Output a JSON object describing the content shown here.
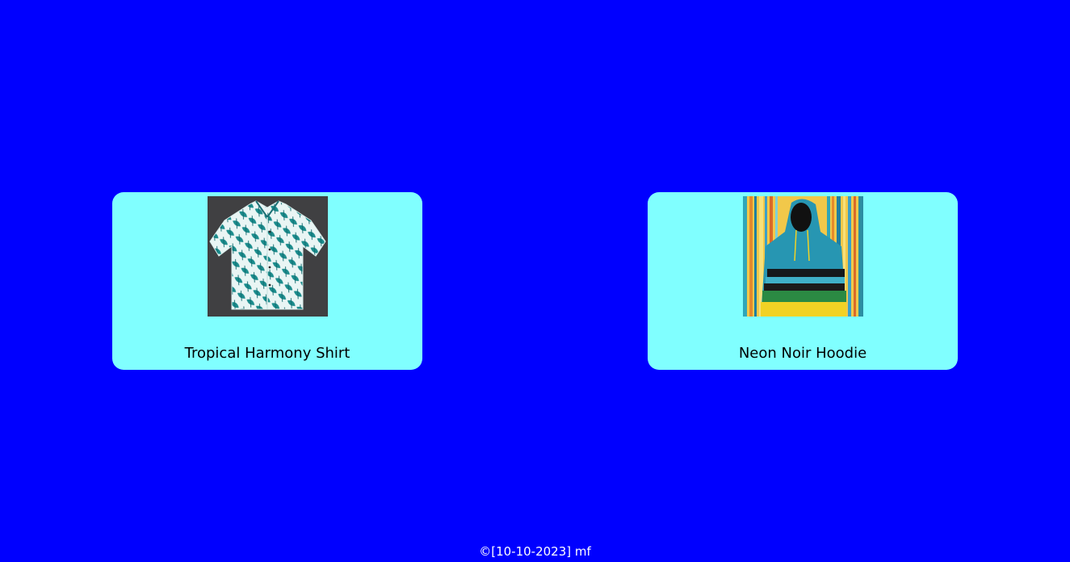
{
  "products": [
    {
      "name": "Tropical Harmony Shirt",
      "image": "tropical-shirt-photo"
    },
    {
      "name": "Neon Noir Hoodie",
      "image": "striped-hoodie-photo"
    }
  ],
  "footer": {
    "text": "©[10-10-2023] mf"
  },
  "colors": {
    "background": "#0000ff",
    "card": "#80ffff",
    "footer_text": "#ffffff"
  }
}
